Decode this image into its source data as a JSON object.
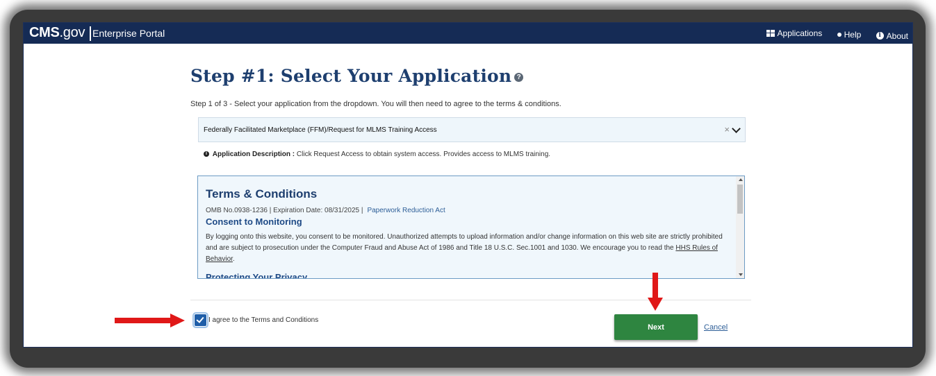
{
  "header": {
    "logo_main": "CMS",
    "logo_suffix": ".gov",
    "portal_name": "Enterprise Portal",
    "nav": [
      {
        "label": "Applications",
        "icon": "grid-icon"
      },
      {
        "label": "Help",
        "icon": "dot-icon"
      },
      {
        "label": "About",
        "icon": "info-icon"
      }
    ]
  },
  "page": {
    "title": "Step #1: Select Your Application",
    "help_glyph": "?",
    "step_text": "Step 1 of 3 - Select your application from the dropdown. You will then need to agree to the terms & conditions."
  },
  "application_select": {
    "value": "Federally Facilitated Marketplace (FFM)/Request for MLMS Training Access",
    "clear_glyph": "×"
  },
  "description": {
    "icon_glyph": "i",
    "label": "Application Description :",
    "text": "Click Request Access to obtain system access. Provides access to MLMS training."
  },
  "terms": {
    "heading": "Terms & Conditions",
    "omb_text": "OMB No.0938-1236 | Expiration Date: 08/31/2025 |",
    "paperwork_link": "Paperwork Reduction Act",
    "consent_heading": "Consent to Monitoring",
    "consent_text": "By logging onto this website, you consent to be monitored. Unauthorized attempts to upload information and/or change information on this web site are strictly prohibited and are subject to prosecution under the Computer Fraud and Abuse Act of 1986 and Title 18 U.S.C. Sec.1001 and 1030. We encourage you to read the",
    "hhs_link": "HHS Rules of Behavior",
    "consent_end": ".",
    "privacy_heading": "Protecting Your Privacy"
  },
  "agree": {
    "checked": true,
    "label": "I agree to the Terms and Conditions"
  },
  "actions": {
    "next_label": "Next",
    "cancel_label": "Cancel"
  },
  "colors": {
    "header_bg": "#152b55",
    "title": "#1e3f6f",
    "next_button": "#2e8540",
    "annotation_arrow": "#e01818"
  }
}
